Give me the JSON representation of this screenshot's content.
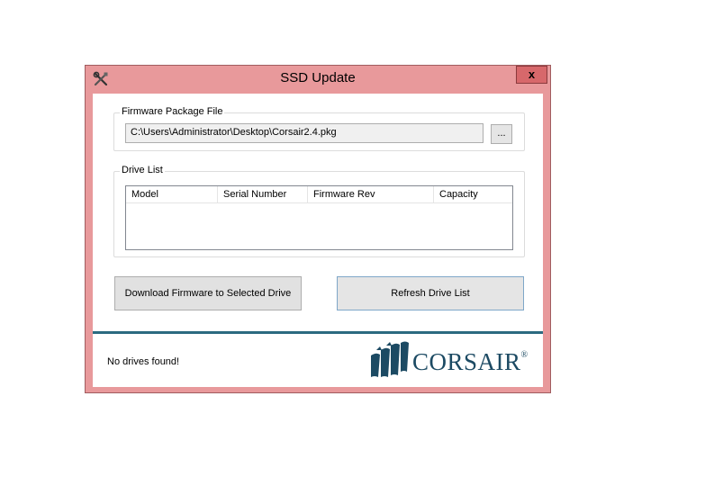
{
  "window": {
    "title": "SSD Update",
    "close_label": "x"
  },
  "firmware_group": {
    "label": "Firmware Package File",
    "path_value": "C:\\Users\\Administrator\\Desktop\\Corsair2.4.pkg",
    "browse_label": "..."
  },
  "drive_list_group": {
    "label": "Drive List",
    "columns": [
      "Model",
      "Serial Number",
      "Firmware Rev",
      "Capacity"
    ],
    "rows": []
  },
  "buttons": {
    "download_label": "Download Firmware to Selected Drive",
    "refresh_label": "Refresh Drive List"
  },
  "status": {
    "text": "No drives found!"
  },
  "logo": {
    "text": "CORSAIR",
    "reg_mark": "®"
  },
  "colors": {
    "window_frame": "#e8999b",
    "close_button": "#d7686b",
    "divider": "#2b6a80",
    "logo": "#1c4a63"
  },
  "icons": {
    "app": "tools-icon",
    "close": "close-icon",
    "logo": "sails-icon"
  }
}
